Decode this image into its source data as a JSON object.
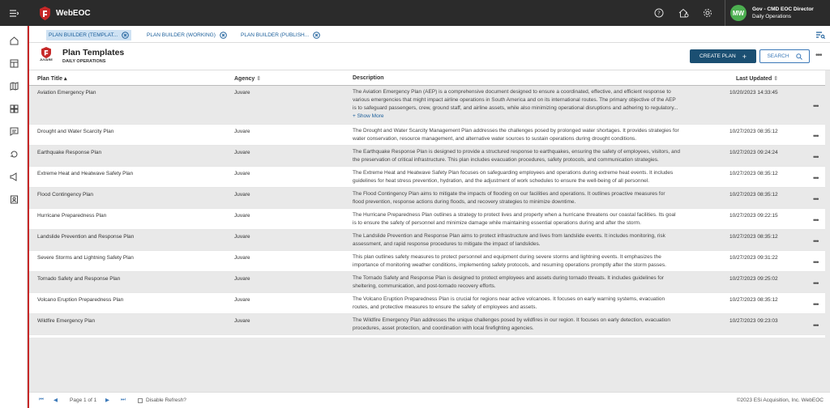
{
  "app": {
    "title": "WebEOC"
  },
  "user": {
    "initials": "MW",
    "name": "Gov - CMD EOC Director",
    "role": "Daily Operations"
  },
  "tabs": [
    {
      "label": "PLAN BUILDER (TEMPLAT...",
      "active": true
    },
    {
      "label": "PLAN BUILDER (WORKING)",
      "active": false
    },
    {
      "label": "PLAN BUILDER (PUBLISH...",
      "active": false
    }
  ],
  "header": {
    "logo_text": "JUVARE",
    "title": "Plan Templates",
    "subtitle": "DAILY OPERATIONS",
    "create_label": "CREATE PLAN",
    "search_label": "SEARCH"
  },
  "columns": {
    "title": "Plan Title",
    "agency": "Agency",
    "description": "Description",
    "updated": "Last Updated"
  },
  "rows": [
    {
      "title": "Aviation Emergency Plan",
      "agency": "Juvare",
      "desc": [
        "The Aviation Emergency Plan (AEP) is a comprehensive document designed to ensure a coordinated, effective, and efficient response to",
        "various emergencies that might impact airline operations in South America and on its international routes. The primary objective of the AEP",
        "is to safeguard passengers, crew, ground staff, and airline assets, while also minimizing operational disruptions and adhering to regulatory..."
      ],
      "show_more": "+ Show More",
      "updated": "10/20/2023 14:33:45"
    },
    {
      "title": "Drought and Water Scarcity Plan",
      "agency": "Juvare",
      "desc": [
        "The Drought and Water Scarcity Management Plan addresses the challenges posed by prolonged water shortages. It provides strategies for",
        "water conservation, resource management, and alternative water sources to sustain operations during drought conditions."
      ],
      "updated": "10/27/2023 08:35:12"
    },
    {
      "title": "Earthquake Response Plan",
      "agency": "Juvare",
      "desc": [
        "The Earthquake Response Plan is designed to provide a structured response to earthquakes, ensuring the safety of employees, visitors, and",
        "the preservation of critical infrastructure. This plan includes evacuation procedures, safety protocols, and communication strategies."
      ],
      "updated": "10/27/2023 09:24:24"
    },
    {
      "title": "Extreme Heat and Heatwave Safety Plan",
      "agency": "Juvare",
      "desc": [
        "The Extreme Heat and Heatwave Safety Plan focuses on safeguarding employees and operations during extreme heat events. It includes",
        "guidelines for heat stress prevention, hydration, and the adjustment of work schedules to ensure the well-being of all personnel."
      ],
      "updated": "10/27/2023 08:35:12"
    },
    {
      "title": "Flood Contingency Plan",
      "agency": "Juvare",
      "desc": [
        "The Flood Contingency Plan aims to mitigate the impacts of flooding on our facilities and operations. It outlines proactive measures for",
        "flood prevention, response actions during floods, and recovery strategies to minimize downtime."
      ],
      "updated": "10/27/2023 08:35:12"
    },
    {
      "title": "Hurricane Preparedness Plan",
      "agency": "Juvare",
      "desc": [
        "The Hurricane Preparedness Plan outlines a strategy to protect lives and property when a hurricane threatens our coastal facilities. Its goal",
        "is to ensure the safety of personnel and minimize damage while maintaining essential operations during and after the storm."
      ],
      "updated": "10/27/2023 09:22:15"
    },
    {
      "title": "Landslide Prevention and Response Plan",
      "agency": "Juvare",
      "desc": [
        "The Landslide Prevention and Response Plan aims to protect infrastructure and lives from landslide events. It includes monitoring, risk",
        "assessment, and rapid response procedures to mitigate the impact of landslides."
      ],
      "updated": "10/27/2023 08:35:12"
    },
    {
      "title": "Severe Storms and Lightning Safety Plan",
      "agency": "Juvare",
      "desc": [
        "This plan outlines safety measures to protect personnel and equipment during severe storms and lightning events. It emphasizes the",
        "importance of monitoring weather conditions, implementing safety protocols, and resuming operations promptly after the storm passes."
      ],
      "updated": "10/27/2023 09:31:22"
    },
    {
      "title": "Tornado Safety and Response Plan",
      "agency": "Juvare",
      "desc": [
        "The Tornado Safety and Response Plan is designed to protect employees and assets during tornado threats. It includes guidelines for",
        "sheltering, communication, and post-tornado recovery efforts."
      ],
      "updated": "10/27/2023 09:25:02"
    },
    {
      "title": "Volcano Eruption Preparedness Plan",
      "agency": "Juvare",
      "desc": [
        "The Volcano Eruption Preparedness Plan is crucial for regions near active volcanoes. It focuses on early warning systems, evacuation",
        "routes, and protective measures to ensure the safety of employees and assets."
      ],
      "updated": "10/27/2023 08:35:12"
    },
    {
      "title": "Wildfire Emergency Plan",
      "agency": "Juvare",
      "desc": [
        "The Wildfire Emergency Plan addresses the unique challenges posed by wildfires in our region. It focuses on early detection, evacuation",
        "procedures, asset protection, and coordination with local firefighting agencies."
      ],
      "updated": "10/27/2023 09:23:03"
    }
  ],
  "footer": {
    "page_text": "Page 1 of 1",
    "refresh_label": "Disable Refresh?",
    "copyright": "©2023 ESi Acquisition, Inc. WebEOC"
  },
  "colors": {
    "topbar": "#2b2b2b",
    "accent_red": "#c62828",
    "primary_blue": "#1b4f72",
    "link_blue": "#3a78b8",
    "avatar_green": "#4caf50"
  }
}
